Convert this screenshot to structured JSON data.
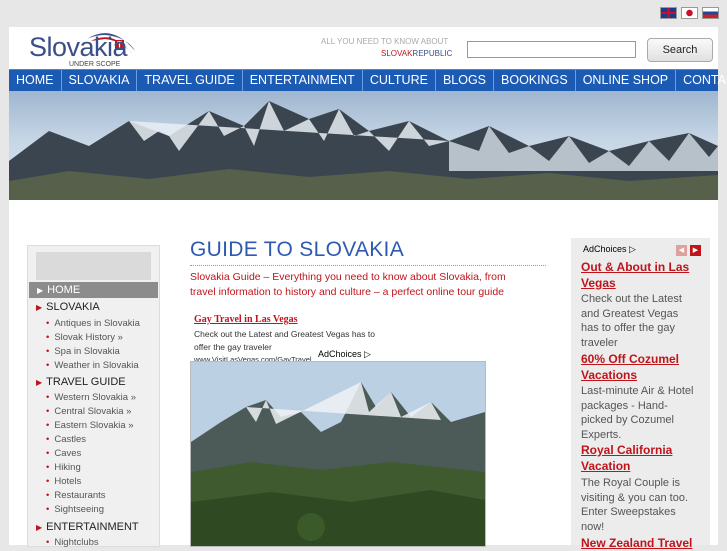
{
  "flags": [
    "english-flag",
    "japanese-flag",
    "slovak-flag"
  ],
  "header": {
    "logo": "Slovakia",
    "logo_sub": "UNDER SCOPE",
    "tagline_top": "ALL YOU NEED TO KNOW ABOUT",
    "tagline_red": "SLOVAK",
    "tagline_blue": "REPUBLIC",
    "search_value": "",
    "search_button": "Search"
  },
  "nav": [
    "HOME",
    "SLOVAKIA",
    "TRAVEL GUIDE",
    "ENTERTAINMENT",
    "CULTURE",
    "BLOGS",
    "BOOKINGS",
    "ONLINE SHOP",
    "CONTACT"
  ],
  "sidebar": {
    "home": "HOME",
    "sections": [
      {
        "label": "SLOVAKIA",
        "items": [
          "Antiques in Slovakia",
          "Slovak History »",
          "Spa in Slovakia",
          "Weather in Slovakia"
        ]
      },
      {
        "label": "TRAVEL GUIDE",
        "items": [
          "Western Slovakia »",
          "Central Slovakia »",
          "Eastern Slovakia »",
          "Castles",
          "Caves",
          "Hiking",
          "Hotels",
          "Restaurants",
          "Sightseeing"
        ]
      },
      {
        "label": "ENTERTAINMENT",
        "items": [
          "Nightclubs"
        ]
      }
    ]
  },
  "main": {
    "title": "GUIDE TO SLOVAKIA",
    "intro": "Slovakia Guide – Everything you need to know about Slovakia, from travel information to history and culture – a perfect online tour guide",
    "ad": {
      "title": "Gay Travel in Las Vegas",
      "body": "Check out the Latest and Greatest Vegas has to offer the gay traveler",
      "url": "www.VisitLasVegas.com/GayTravel",
      "adchoices": "AdChoices ▷"
    }
  },
  "right": {
    "adchoices": "AdChoices ▷",
    "ads": [
      {
        "title": "Out & About in Las Vegas",
        "body": "Check out the Latest and Greatest Vegas has to offer the gay traveler"
      },
      {
        "title": "60% Off Cozumel Vacations",
        "body": "Last-minute Air & Hotel packages - Hand-picked by Cozumel Experts."
      },
      {
        "title": "Royal California Vacation",
        "body": "The Royal Couple is visiting & you can too. Enter Sweepstakes now!"
      },
      {
        "title": "New Zealand Travel",
        "body": ""
      }
    ]
  },
  "colors": {
    "nav_blue": "#1c5bb4",
    "accent_red": "#c0141b",
    "title_blue": "#2d5ab0"
  }
}
